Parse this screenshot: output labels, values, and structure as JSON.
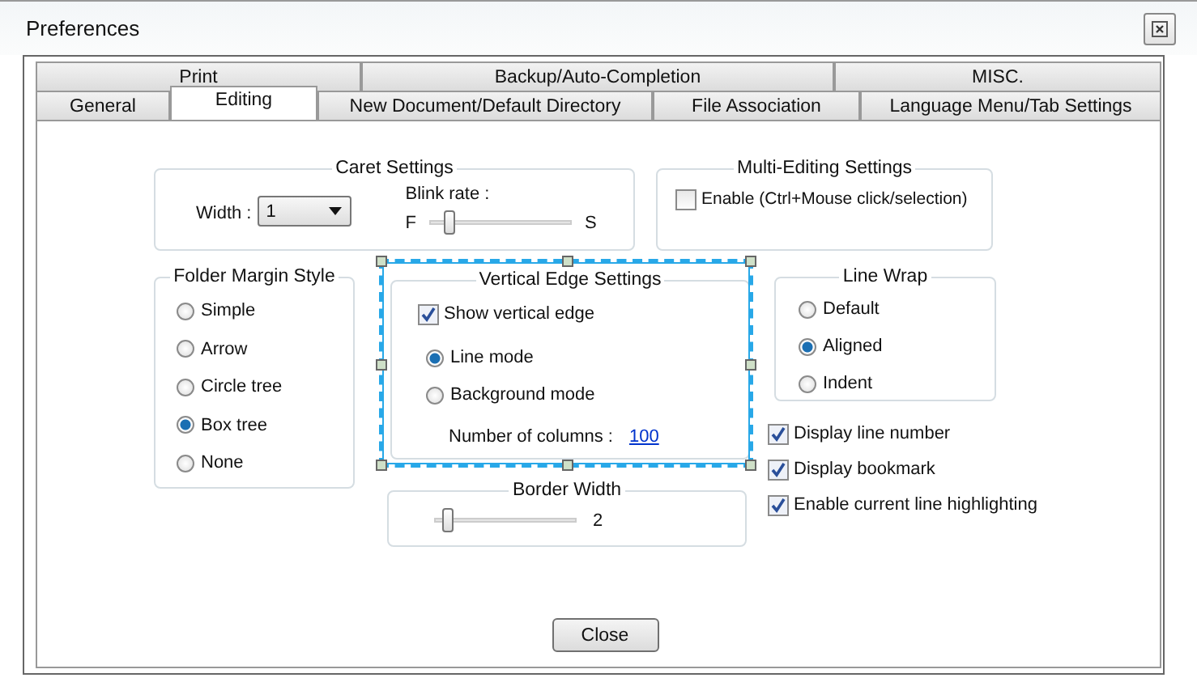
{
  "window": {
    "title": "Preferences"
  },
  "tab_rows": [
    [
      {
        "label": "Print",
        "selected": false
      },
      {
        "label": "Backup/Auto-Completion",
        "selected": false
      },
      {
        "label": "MISC.",
        "selected": false
      }
    ],
    [
      {
        "label": "General",
        "selected": false
      },
      {
        "label": "Editing",
        "selected": true
      },
      {
        "label": "New Document/Default Directory",
        "selected": false
      },
      {
        "label": "File Association",
        "selected": false
      },
      {
        "label": "Language Menu/Tab Settings",
        "selected": false
      }
    ]
  ],
  "caret_settings": {
    "title": "Caret Settings",
    "width_label": "Width :",
    "width_value": "1",
    "blink_label": "Blink rate :",
    "blink_min": "F",
    "blink_max": "S",
    "blink": {
      "level": 0.1
    }
  },
  "multi_editing": {
    "title": "Multi-Editing Settings",
    "enable": {
      "label": "Enable (Ctrl+Mouse click/selection)",
      "checked": false
    }
  },
  "folder_margin_style": {
    "title": "Folder Margin Style",
    "options": [
      {
        "label": "Simple",
        "selected": false
      },
      {
        "label": "Arrow",
        "selected": false
      },
      {
        "label": "Circle tree",
        "selected": false
      },
      {
        "label": "Box tree",
        "selected": true
      },
      {
        "label": "None",
        "selected": false
      }
    ]
  },
  "vertical_edge": {
    "title": "Vertical Edge Settings",
    "highlighted": true,
    "show": {
      "label": "Show vertical edge",
      "checked": true
    },
    "modes": [
      {
        "label": "Line mode",
        "selected": true
      },
      {
        "label": "Background mode",
        "selected": false
      }
    ],
    "columns_label": "Number of columns :",
    "columns_value": "100"
  },
  "border_width": {
    "title": "Border Width",
    "level": 0.06,
    "reading": "2"
  },
  "line_wrap": {
    "title": "Line Wrap",
    "options": [
      {
        "label": "Default",
        "selected": false
      },
      {
        "label": "Aligned",
        "selected": true
      },
      {
        "label": "Indent",
        "selected": false
      }
    ]
  },
  "display_options": [
    {
      "label": "Display line number",
      "checked": true
    },
    {
      "label": "Display bookmark",
      "checked": true
    },
    {
      "label": "Enable current line highlighting",
      "checked": true
    }
  ],
  "buttons": [
    "Close"
  ]
}
